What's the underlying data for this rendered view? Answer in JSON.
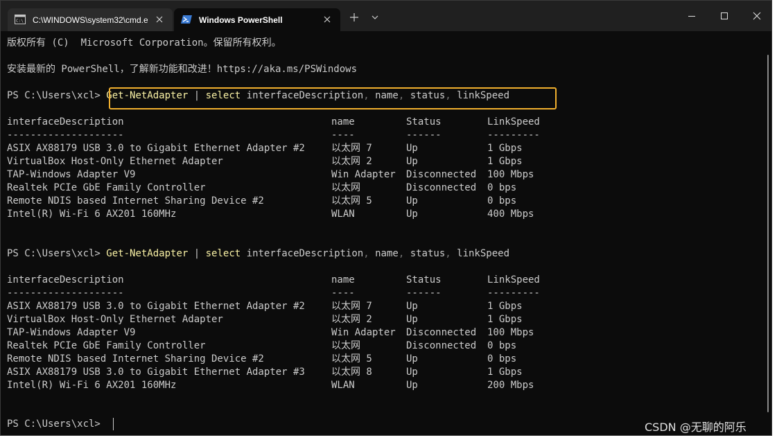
{
  "tabs": [
    {
      "title": "C:\\WINDOWS\\system32\\cmd.e",
      "active": false,
      "icon": "cmd-icon"
    },
    {
      "title": "Windows PowerShell",
      "active": true,
      "icon": "powershell-icon"
    }
  ],
  "titlebar": {
    "new_tab": "+",
    "dropdown": "chevron-down",
    "minimize": "minimize",
    "maximize": "maximize",
    "close": "close"
  },
  "terminal": {
    "copyright": "版权所有 (C)  Microsoft Corporation。保留所有权利。",
    "install_msg": "安装最新的 PowerShell，了解新功能和改进！https://aka.ms/PSWindows",
    "prompt": "PS C:\\Users\\xcl>",
    "cmd_name": "Get-NetAdapter",
    "cmd_pipe": "|",
    "cmd_select": "select",
    "cmd_args": [
      {
        "text": "interfaceDescription",
        "sep": ","
      },
      {
        "text": "name",
        "sep": ","
      },
      {
        "text": "status",
        "sep": ","
      },
      {
        "text": "linkSpeed",
        "sep": ""
      }
    ],
    "headers": {
      "desc": "interfaceDescription",
      "name": "name",
      "status": "Status",
      "speed": "LinkSpeed"
    },
    "underlines": {
      "desc": "--------------------",
      "name": "----",
      "status": "------",
      "speed": "---------"
    },
    "output1": [
      {
        "desc": "ASIX AX88179 USB 3.0 to Gigabit Ethernet Adapter #2",
        "name": "以太网 7",
        "status": "Up",
        "speed": "1 Gbps"
      },
      {
        "desc": "VirtualBox Host-Only Ethernet Adapter",
        "name": "以太网 2",
        "status": "Up",
        "speed": "1 Gbps"
      },
      {
        "desc": "TAP-Windows Adapter V9",
        "name": "Win Adapter",
        "status": "Disconnected",
        "speed": "100 Mbps"
      },
      {
        "desc": "Realtek PCIe GbE Family Controller",
        "name": "以太网",
        "status": "Disconnected",
        "speed": "0 bps"
      },
      {
        "desc": "Remote NDIS based Internet Sharing Device #2",
        "name": "以太网 5",
        "status": "Up",
        "speed": "0 bps"
      },
      {
        "desc": "Intel(R) Wi-Fi 6 AX201 160MHz",
        "name": "WLAN",
        "status": "Up",
        "speed": "400 Mbps"
      }
    ],
    "output2": [
      {
        "desc": "ASIX AX88179 USB 3.0 to Gigabit Ethernet Adapter #2",
        "name": "以太网 7",
        "status": "Up",
        "speed": "1 Gbps"
      },
      {
        "desc": "VirtualBox Host-Only Ethernet Adapter",
        "name": "以太网 2",
        "status": "Up",
        "speed": "1 Gbps"
      },
      {
        "desc": "TAP-Windows Adapter V9",
        "name": "Win Adapter",
        "status": "Disconnected",
        "speed": "100 Mbps"
      },
      {
        "desc": "Realtek PCIe GbE Family Controller",
        "name": "以太网",
        "status": "Disconnected",
        "speed": "0 bps"
      },
      {
        "desc": "Remote NDIS based Internet Sharing Device #2",
        "name": "以太网 5",
        "status": "Up",
        "speed": "0 bps"
      },
      {
        "desc": "ASIX AX88179 USB 3.0 to Gigabit Ethernet Adapter #3",
        "name": "以太网 8",
        "status": "Up",
        "speed": "1 Gbps"
      },
      {
        "desc": "Intel(R) Wi-Fi 6 AX201 160MHz",
        "name": "WLAN",
        "status": "Up",
        "speed": "200 Mbps"
      }
    ]
  },
  "watermark": "CSDN @无聊的阿乐",
  "colors": {
    "background": "#0c0c0c",
    "text": "#cccccc",
    "command": "#f9f1a5",
    "comma": "#767676",
    "highlight": "#f2b02e",
    "titlebar": "#202020"
  }
}
